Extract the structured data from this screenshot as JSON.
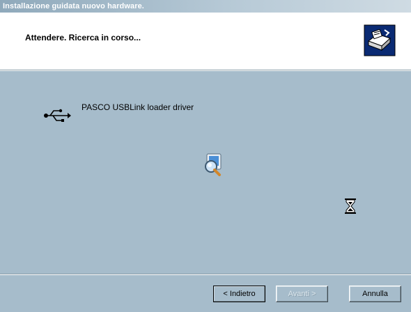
{
  "window": {
    "title": "Installazione guidata nuovo hardware."
  },
  "header": {
    "title": "Attendere. Ricerca in corso...",
    "icon": "hardware-wizard-icon"
  },
  "main": {
    "device_icon": "usb-icon",
    "device_name": "PASCO USBLink loader driver",
    "search_icon": "search-magnifier-icon",
    "wait_icon": "hourglass-icon"
  },
  "footer": {
    "back_label": "< Indietro",
    "next_label": "Avanti >",
    "cancel_label": "Annulla"
  },
  "colors": {
    "background": "#a6bccb",
    "header_background": "#ffffff",
    "title_text": "#ffffff"
  }
}
